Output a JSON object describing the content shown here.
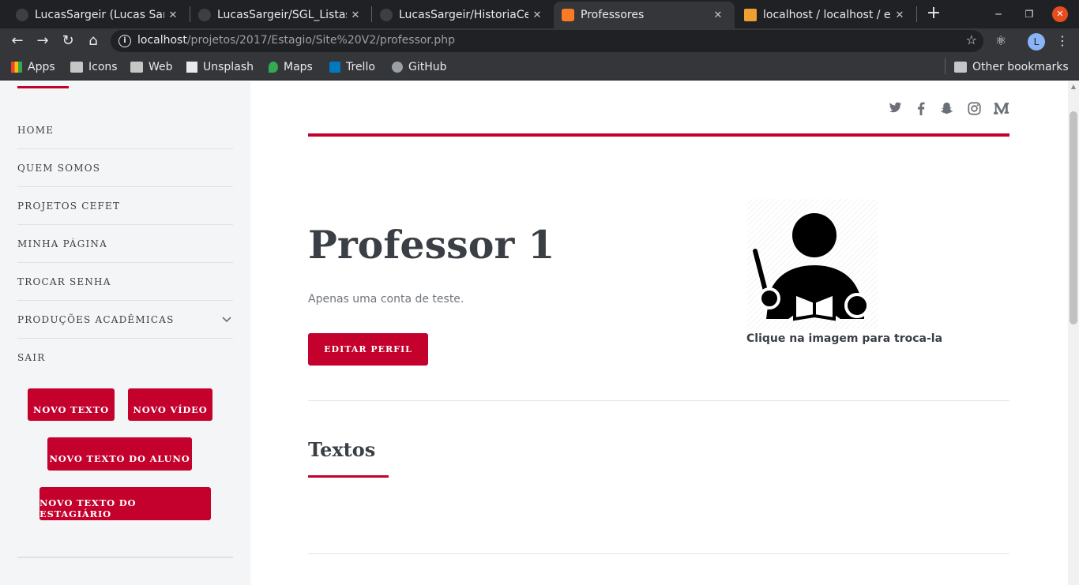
{
  "browser": {
    "tabs": [
      {
        "title": "LucasSargeir (Lucas Sarg",
        "icon": "github-icon"
      },
      {
        "title": "LucasSargeir/SGL_Listas",
        "icon": "github-icon"
      },
      {
        "title": "LucasSargeir/HistoriaCe",
        "icon": "github-icon"
      },
      {
        "title": "Professores",
        "icon": "xampp-icon",
        "active": true
      },
      {
        "title": "localhost / localhost / es",
        "icon": "phpmyadmin-icon"
      }
    ],
    "close_glyph": "✕",
    "new_tab_glyph": "+",
    "url_host": "localhost",
    "url_path": "/projetos/2017/Estagio/Site%20V2/professor.php",
    "profile_initial": "L",
    "bookmarks": [
      {
        "label": "Apps",
        "icon": "apps-grid-icon"
      },
      {
        "label": "Icons",
        "icon": "folder-icon"
      },
      {
        "label": "Web",
        "icon": "folder-icon"
      },
      {
        "label": "Unsplash",
        "icon": "unsplash-icon"
      },
      {
        "label": "Maps",
        "icon": "maps-icon"
      },
      {
        "label": "Trello",
        "icon": "trello-icon"
      },
      {
        "label": "GitHub",
        "icon": "github-icon"
      }
    ],
    "other_bookmarks": "Other bookmarks"
  },
  "sidebar": {
    "menu": [
      {
        "label": "HOME"
      },
      {
        "label": "QUEM SOMOS"
      },
      {
        "label": "PROJETOS CEFET"
      },
      {
        "label": "MINHA PÁGINA"
      },
      {
        "label": "TROCAR SENHA"
      },
      {
        "label": "PRODUÇÕES ACADÊMICAS",
        "has_submenu": true
      },
      {
        "label": "SAIR"
      }
    ],
    "buttons": {
      "novo_texto": "NOVO TEXTO",
      "novo_video": "NOVO VÍDEO",
      "novo_texto_aluno": "NOVO TEXTO DO ALUNO",
      "novo_texto_estagiario": "NOVO TEXTO DO ESTAGIÁRIO"
    }
  },
  "social": [
    "twitter-icon",
    "facebook-icon",
    "snapchat-icon",
    "instagram-icon",
    "medium-icon"
  ],
  "profile": {
    "name": "Professor 1",
    "description": "Apenas uma conta de teste.",
    "edit_button": "EDITAR PERFIL",
    "image_caption": "Clique na imagem para troca-la"
  },
  "section": {
    "title": "Textos"
  },
  "colors": {
    "accent": "#c4002c",
    "sidebar_bg": "#f4f5f7",
    "text_dark": "#3a3f45",
    "chrome_dark": "#202124",
    "chrome_mid": "#35363a"
  }
}
